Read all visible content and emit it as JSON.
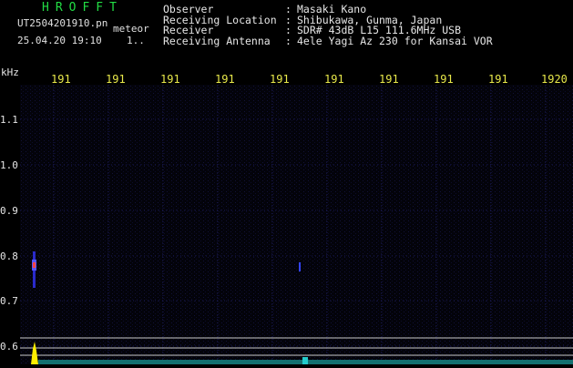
{
  "header": {
    "app_title": "HROFFT",
    "file_name": "UT2504201910.pn",
    "mode_tag": "meteor",
    "date_time": "25.04.20 19:10",
    "count_tag": "1.."
  },
  "info": [
    {
      "label": "Observer",
      "value": "Masaki Kano"
    },
    {
      "label": "Receiving Location",
      "value": "Shibukawa, Gunma, Japan"
    },
    {
      "label": "Receiver",
      "value": "SDR# 43dB L15 111.6MHz USB"
    },
    {
      "label": "Receiving Antenna",
      "value": "4ele Yagi Az 230 for Kansai VOR"
    }
  ],
  "colon_separator": ":",
  "axis": {
    "unit_label": "kHz",
    "y_ticks": [
      "1.1",
      "1.0",
      "0.9",
      "0.8",
      "0.7",
      "0.6"
    ],
    "x_ticks": [
      "191",
      "191",
      "191",
      "191",
      "191",
      "191",
      "191",
      "191",
      "191",
      "1920"
    ]
  },
  "colors": {
    "title_green": "#22dd44",
    "tick_yellow": "#e8e84a",
    "echo_blue": "#3344ff",
    "echo_red": "#ff4444",
    "baseline_yellow": "#ffee00",
    "baseline_cyan": "#22cccc"
  }
}
